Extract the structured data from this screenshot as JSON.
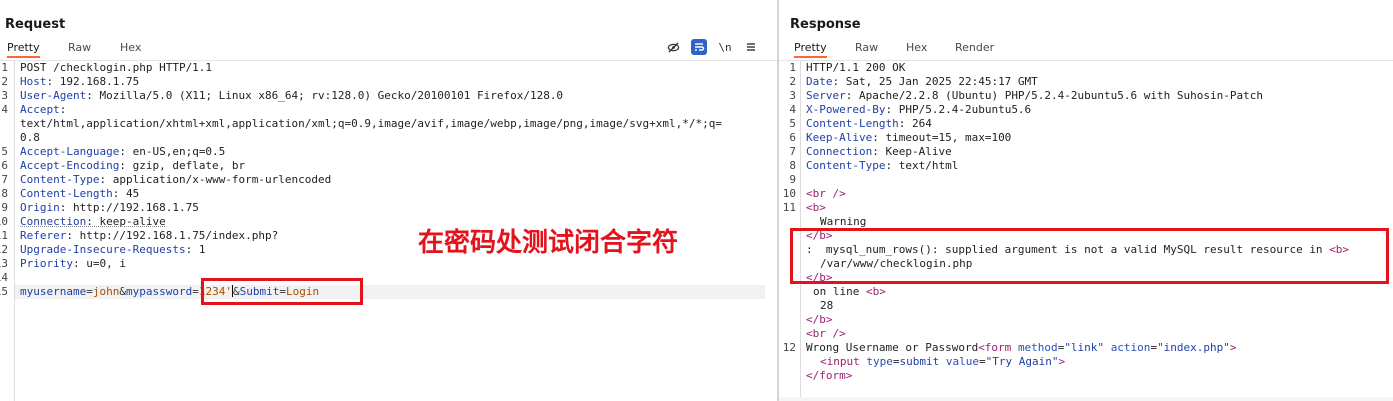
{
  "request": {
    "title": "Request",
    "tabs": [
      "Pretty",
      "Raw",
      "Hex"
    ],
    "active_tab": "Pretty",
    "toolbar_icons": [
      "eye-slash-icon",
      "wrap-lines-icon",
      "newline-icon",
      "menu-icon"
    ],
    "newline_label": "\\n",
    "lines": [
      {
        "num": "1",
        "key": "",
        "rest": "POST /checklogin.php HTTP/1.1"
      },
      {
        "num": "2",
        "key": "Host",
        "rest": ": 192.168.1.75"
      },
      {
        "num": "3",
        "key": "User-Agent",
        "rest": ": Mozilla/5.0 (X11; Linux x86_64; rv:128.0) Gecko/20100101 Firefox/128.0"
      },
      {
        "num": "4",
        "key": "Accept",
        "rest": ":"
      },
      {
        "num": "",
        "key": "",
        "rest": "text/html,application/xhtml+xml,application/xml;q=0.9,image/avif,image/webp,image/png,image/svg+xml,*/*;q="
      },
      {
        "num": "",
        "key": "",
        "rest": "0.8"
      },
      {
        "num": "5",
        "key": "Accept-Language",
        "rest": ": en-US,en;q=0.5"
      },
      {
        "num": "6",
        "key": "Accept-Encoding",
        "rest": ": gzip, deflate, br"
      },
      {
        "num": "7",
        "key": "Content-Type",
        "rest": ": application/x-www-form-urlencoded"
      },
      {
        "num": "8",
        "key": "Content-Length",
        "rest": ": 45"
      },
      {
        "num": "9",
        "key": "Origin",
        "rest": ": http://192.168.1.75"
      },
      {
        "num": "10",
        "key": "Connection",
        "rest": ": keep-alive"
      },
      {
        "num": "11",
        "key": "Referer",
        "rest": ": http://192.168.1.75/index.php?"
      },
      {
        "num": "12",
        "key": "Upgrade-Insecure-Requests",
        "rest": ": 1"
      },
      {
        "num": "13",
        "key": "Priority",
        "rest": ": u=0, i"
      },
      {
        "num": "14",
        "key": "",
        "rest": ""
      }
    ],
    "body_line": {
      "num": "15",
      "p1": "myusername",
      "v1": "john",
      "p2": "mypassword",
      "v2": "1234'",
      "p3": "Submit",
      "v3": "Login"
    }
  },
  "response": {
    "title": "Response",
    "tabs": [
      "Pretty",
      "Raw",
      "Hex",
      "Render"
    ],
    "active_tab": "Pretty",
    "headers": [
      {
        "num": "1",
        "key": "",
        "rest": "HTTP/1.1 200 OK"
      },
      {
        "num": "2",
        "key": "Date",
        "rest": ": Sat, 25 Jan 2025 22:45:17 GMT"
      },
      {
        "num": "3",
        "key": "Server",
        "rest": ": Apache/2.2.8 (Ubuntu) PHP/5.2.4-2ubuntu5.6 with Suhosin-Patch"
      },
      {
        "num": "4",
        "key": "X-Powered-By",
        "rest": ": PHP/5.2.4-2ubuntu5.6"
      },
      {
        "num": "5",
        "key": "Content-Length",
        "rest": ": 264"
      },
      {
        "num": "6",
        "key": "Keep-Alive",
        "rest": ": timeout=15, max=100"
      },
      {
        "num": "7",
        "key": "Connection",
        "rest": ": Keep-Alive"
      },
      {
        "num": "8",
        "key": "Content-Type",
        "rest": ": text/html"
      },
      {
        "num": "9",
        "key": "",
        "rest": ""
      }
    ],
    "body": {
      "l10": {
        "num": "10",
        "tag": "<br />"
      },
      "l11": {
        "num": "11",
        "tag": "<b>"
      },
      "warning": "Warning",
      "close_b": "</b>",
      "msg": ":  mysql_num_rows(): supplied argument is not a valid MySQL result resource in ",
      "msg_tag": "<b>",
      "path": "/var/www/checklogin.php",
      "close_b2": "</b>",
      "online": "on line ",
      "online_tag": "<b>",
      "line_no": "28",
      "close_b3": "</b>",
      "br": "<br />",
      "l12": {
        "num": "12",
        "text": "Wrong Username or Password",
        "form_open": "<form",
        "attr_method": "method",
        "val_method": "\"link\"",
        "attr_action": "action",
        "val_action": "\"index.php\"",
        "gt": ">"
      },
      "input": {
        "open": "<input",
        "attr_type": "type",
        "val_type": "submit",
        "attr_value": "value",
        "val_value": "\"Try Again\"",
        "close": ">"
      },
      "form_close": "</form>"
    }
  },
  "annotation": "在密码处测试闭合字符",
  "colors": {
    "accent": "#ff6633",
    "annotation_red": "#e3131c",
    "header_key": "#1f3fa8",
    "html_tag": "#9a1f73",
    "param_value": "#ad4c00"
  }
}
